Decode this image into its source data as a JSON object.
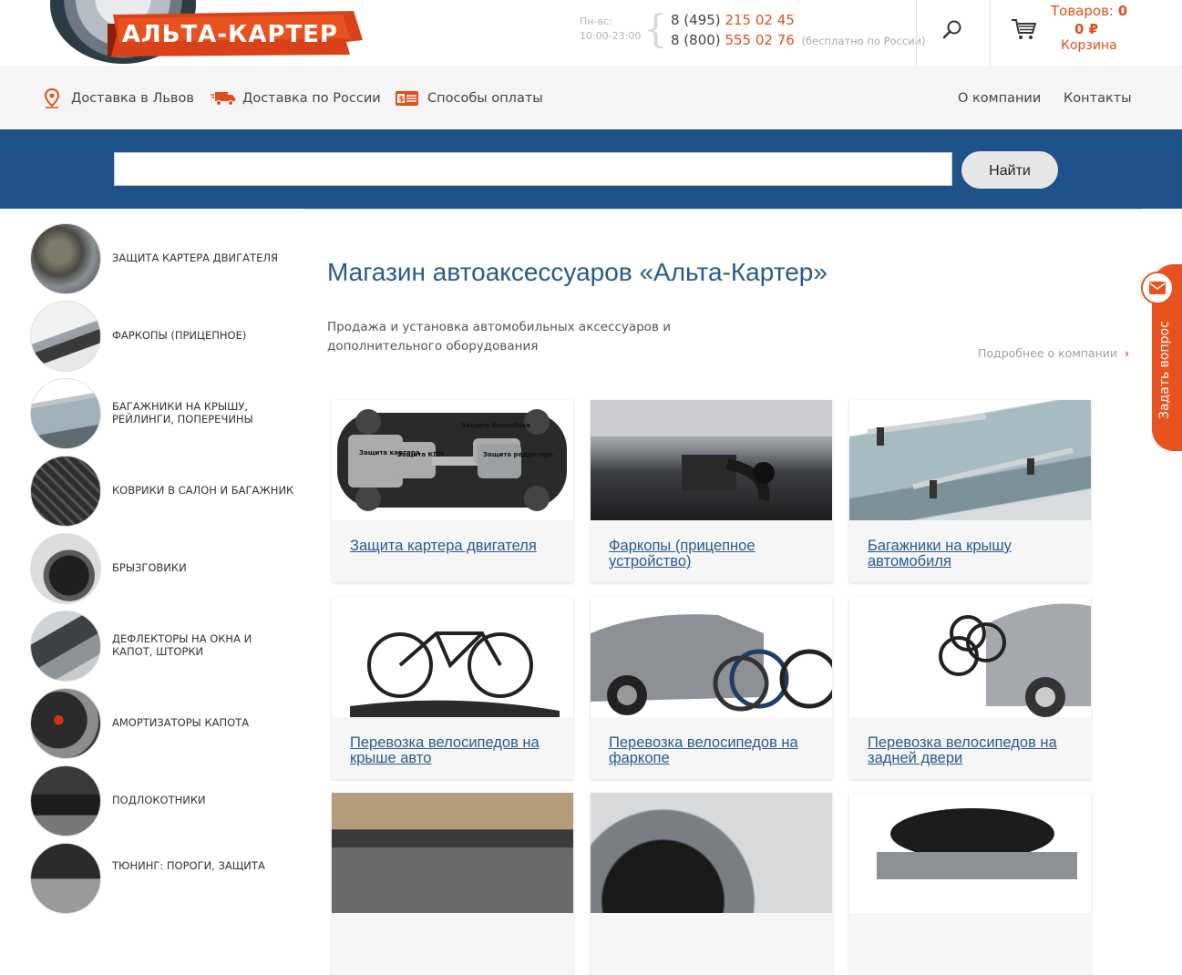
{
  "header": {
    "logo_text": "АЛЬТА-КАРТЕР",
    "hours_label": "Пн-вс:",
    "hours_value": "10:00-23:00",
    "phone1_prefix": "8 (495)",
    "phone1_number": "215 02 45",
    "phone2_prefix": "8 (800)",
    "phone2_number": "555 02 76",
    "phone2_note": "(бесплатно по России)",
    "cart_goods_label": "Товаров:",
    "cart_goods_count": "0",
    "cart_sum": "0",
    "cart_currency": "₽",
    "cart_label": "Корзина"
  },
  "nav": {
    "delivery_lviv": "Доставка в Львов",
    "delivery_russia": "Доставка по России",
    "payment": "Способы оплаты",
    "about": "О компании",
    "contacts": "Контакты"
  },
  "search": {
    "value": "",
    "button": "Найти"
  },
  "sidebar": {
    "items": [
      {
        "label": "Защита картера двигателя"
      },
      {
        "label": "Фаркопы (прицепное)"
      },
      {
        "label": "Багажники на крышу, рейлинги, поперечины"
      },
      {
        "label": "Коврики в салон и багажник"
      },
      {
        "label": "Брызговики"
      },
      {
        "label": "Дефлекторы на окна и капот, шторки"
      },
      {
        "label": "Амортизаторы капота"
      },
      {
        "label": "Подлокотники"
      },
      {
        "label": "Тюнинг: пороги, защита"
      }
    ]
  },
  "main": {
    "title": "Магазин автоаксессуаров «Альта-Картер»",
    "description": "Продажа и установка автомобильных аксессуаров и дополнительного оборудования",
    "more_link": "Подробнее о компании",
    "cards": [
      {
        "title": "Защита картера двигателя",
        "img_labels": [
          "Защита картера",
          "Защита КПП",
          "Защита бензобака",
          "Защита редуктора"
        ]
      },
      {
        "title": "Фаркопы (прицепное устройство)"
      },
      {
        "title": "Багажники на крышу автомобиля"
      },
      {
        "title": "Перевозка велосипедов на крыше авто"
      },
      {
        "title": "Перевозка велосипедов на фаркопе"
      },
      {
        "title": "Перевозка велосипедов на задней двери"
      },
      {
        "title": ""
      },
      {
        "title": ""
      },
      {
        "title": ""
      }
    ]
  },
  "feedback": {
    "label": "Задать вопрос"
  },
  "colors": {
    "accent": "#e04e1b",
    "brand_blue": "#1e5288",
    "title_blue": "#2a5a8a"
  }
}
